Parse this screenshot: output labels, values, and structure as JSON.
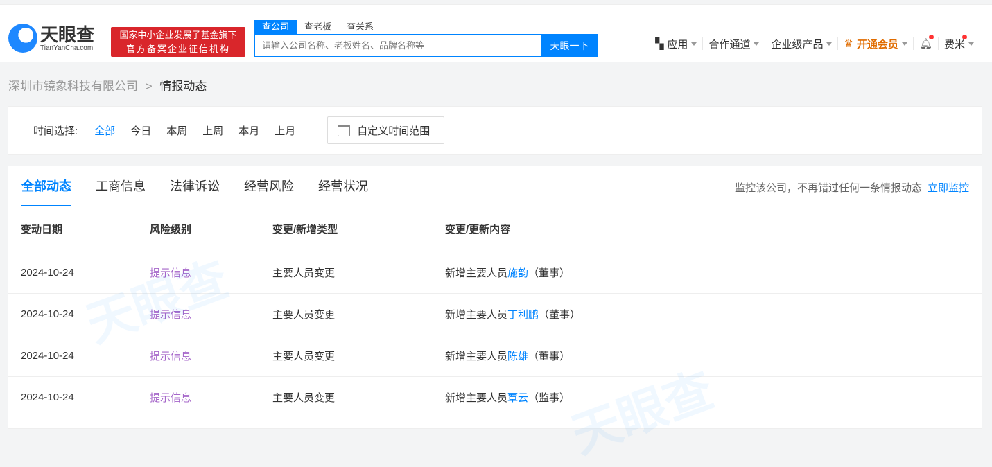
{
  "header": {
    "logo_cn": "天眼查",
    "logo_en": "TianYanCha.com",
    "badge_line1": "国家中小企业发展子基金旗下",
    "badge_line2": "官方备案企业征信机构",
    "search_tabs": [
      "查公司",
      "查老板",
      "查关系"
    ],
    "search_placeholder": "请输入公司名称、老板姓名、品牌名称等",
    "search_button": "天眼一下",
    "nav": {
      "apps": "应用",
      "partner": "合作通道",
      "enterprise": "企业级产品",
      "vip": "开通会员",
      "user": "费米"
    }
  },
  "breadcrumb": {
    "company": "深圳市镜象科技有限公司",
    "separator": ">",
    "current": "情报动态"
  },
  "filter": {
    "label": "时间选择:",
    "options": [
      "全部",
      "今日",
      "本周",
      "上周",
      "本月",
      "上月"
    ],
    "custom": "自定义时间范围"
  },
  "tabs": [
    "全部动态",
    "工商信息",
    "法律诉讼",
    "经营风险",
    "经营状况"
  ],
  "monitor": {
    "text": "监控该公司，不再错过任何一条情报动态",
    "link": "立即监控"
  },
  "table": {
    "headers": [
      "变动日期",
      "风险级别",
      "变更/新增类型",
      "变更/更新内容"
    ],
    "rows": [
      {
        "date": "2024-10-24",
        "risk": "提示信息",
        "type": "主要人员变更",
        "prefix": "新增主要人员",
        "person": "施韵",
        "role": "（董事）"
      },
      {
        "date": "2024-10-24",
        "risk": "提示信息",
        "type": "主要人员变更",
        "prefix": "新增主要人员",
        "person": "丁利鹏",
        "role": "（董事）"
      },
      {
        "date": "2024-10-24",
        "risk": "提示信息",
        "type": "主要人员变更",
        "prefix": "新增主要人员",
        "person": "陈雄",
        "role": "（董事）"
      },
      {
        "date": "2024-10-24",
        "risk": "提示信息",
        "type": "主要人员变更",
        "prefix": "新增主要人员",
        "person": "覃云",
        "role": "（监事）"
      }
    ]
  },
  "watermark": "天眼查"
}
